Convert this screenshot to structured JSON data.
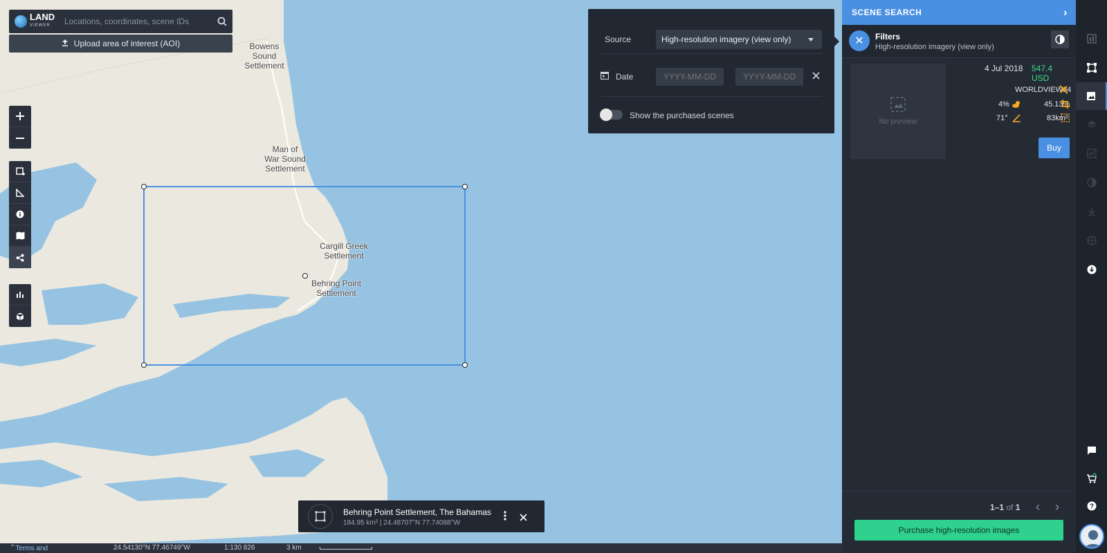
{
  "app": {
    "logo_text": "LAND",
    "logo_sub": "VIEWER"
  },
  "search": {
    "placeholder": "Locations, coordinates, scene IDs"
  },
  "upload": {
    "label": "Upload area of interest (AOI)"
  },
  "places": {
    "bowens": "Bowens Sound\nSettlement",
    "manofwar": "Man of\nWar Sound\nSettlement",
    "cargill": "Cargill Greek\nSettlement",
    "behring": "Behring Point\nSettlement"
  },
  "filter": {
    "source_label": "Source",
    "source_value": "High-resolution imagery (view only)",
    "date_label": "Date",
    "date_from_placeholder": "YYYY-MM-DD",
    "date_to_placeholder": "YYYY-MM-DD",
    "purchased_label": "Show the purchased scenes"
  },
  "aoi": {
    "name": "Behring Point Settlement, The Bahamas",
    "details": "184.95 km² | 24.48707°N 77.74088°W"
  },
  "statusbar": {
    "terms": "Terms and Conditions",
    "coords": "24.54130°N 77.46749°W",
    "scale": "1:130 826",
    "distance": "3 km"
  },
  "panel": {
    "title": "SCENE SEARCH",
    "filters_title": "Filters",
    "filters_sub": "High-resolution imagery (view only)",
    "scene": {
      "date": "4 Jul 2018",
      "price": "547.4 USD",
      "satellite": "WORLDVIEW04",
      "cloud": "4%",
      "coverage": "45.13%",
      "angle": "71°",
      "area": "83km²",
      "no_preview": "No preview",
      "buy": "Buy"
    },
    "pager": {
      "range": "1–1",
      "of": "of",
      "total": "1"
    },
    "purchase": "Purchase high-resolution images"
  },
  "colors": {
    "accent": "#4a90e2",
    "green": "#2ed18d",
    "price": "#3ddc84",
    "icon_orange": "#f5a623"
  }
}
